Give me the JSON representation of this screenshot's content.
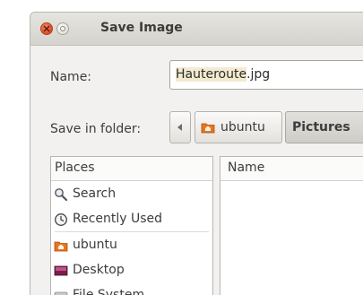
{
  "window": {
    "title": "Save Image"
  },
  "name_row": {
    "label": "Name:",
    "value_selected": "Hauteroute",
    "value_ext": ".jpg"
  },
  "folder_row": {
    "label": "Save in folder:",
    "path": [
      "ubuntu",
      "Pictures"
    ]
  },
  "places": {
    "header": "Places",
    "items": [
      {
        "label": "Search",
        "icon": "search-icon"
      },
      {
        "label": "Recently Used",
        "icon": "recent-icon"
      },
      {
        "label": "ubuntu",
        "icon": "home-folder-icon"
      },
      {
        "label": "Desktop",
        "icon": "desktop-icon"
      },
      {
        "label": "File System",
        "icon": "drive-icon"
      }
    ]
  },
  "files": {
    "header": "Name"
  },
  "colors": {
    "close_button": "#e0532e",
    "home_folder": "#e8761f",
    "selection": "#f3ead0"
  }
}
